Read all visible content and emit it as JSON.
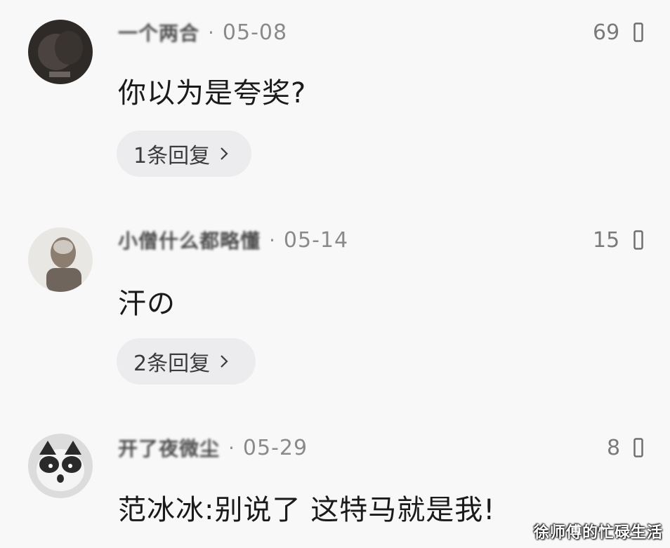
{
  "comments": [
    {
      "username": "一个两合",
      "date": "05-08",
      "likes": "69",
      "text": "你以为是夸奖?",
      "reply_label": "1条回复"
    },
    {
      "username": "小僧什么都略懂",
      "date": "05-14",
      "likes": "15",
      "text": "汗の",
      "reply_label": "2条回复"
    },
    {
      "username": "开了夜微尘",
      "date": "05-29",
      "likes": "8",
      "text": "范冰冰:别说了 这特马就是我!"
    }
  ],
  "separator": "·",
  "icons": {
    "like": "thumb-like-icon",
    "reply_chevron": "chevron-right-icon"
  },
  "watermark": "徐师傅的忙碌生活"
}
